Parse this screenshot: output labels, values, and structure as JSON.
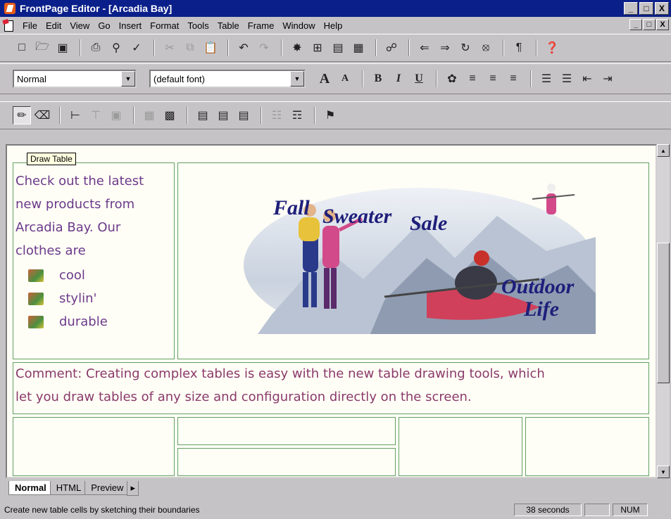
{
  "window": {
    "title": "FrontPage Editor - [Arcadia Bay]",
    "min": "_",
    "max": "□",
    "close": "X"
  },
  "mdi": {
    "min": "_",
    "restore": "□",
    "close": "X"
  },
  "menu": [
    {
      "label": "File"
    },
    {
      "label": "Edit"
    },
    {
      "label": "View"
    },
    {
      "label": "Go"
    },
    {
      "label": "Insert"
    },
    {
      "label": "Format"
    },
    {
      "label": "Tools"
    },
    {
      "label": "Table"
    },
    {
      "label": "Frame"
    },
    {
      "label": "Window"
    },
    {
      "label": "Help"
    }
  ],
  "format": {
    "style": "Normal",
    "font": "(default font)"
  },
  "tooltip": "Draw Table",
  "document": {
    "intro": [
      "Check out the latest",
      "new products from",
      "Arcadia Bay.  Our",
      "clothes are"
    ],
    "bullets": [
      "cool",
      "stylin'",
      "durable"
    ],
    "banner": {
      "title_a": "Fall",
      "title_b": "Sweater",
      "title_c": "Sale",
      "sub_a": "Outdoor",
      "sub_b": "Life"
    },
    "comment_1": "Comment: Creating complex tables is easy with the new table drawing tools, which",
    "comment_2": "let you draw tables of any size and configuration directly on the screen."
  },
  "tabs": [
    "Normal",
    "HTML",
    "Preview"
  ],
  "status": {
    "message": "Create new table cells by sketching their boundaries",
    "time": "38 seconds",
    "num": "NUM"
  },
  "colors": {
    "titlebar": "#0a1f8a",
    "chrome": "#c6c3c6",
    "text_purple": "#6b3a8a",
    "grid": "#62a062"
  }
}
